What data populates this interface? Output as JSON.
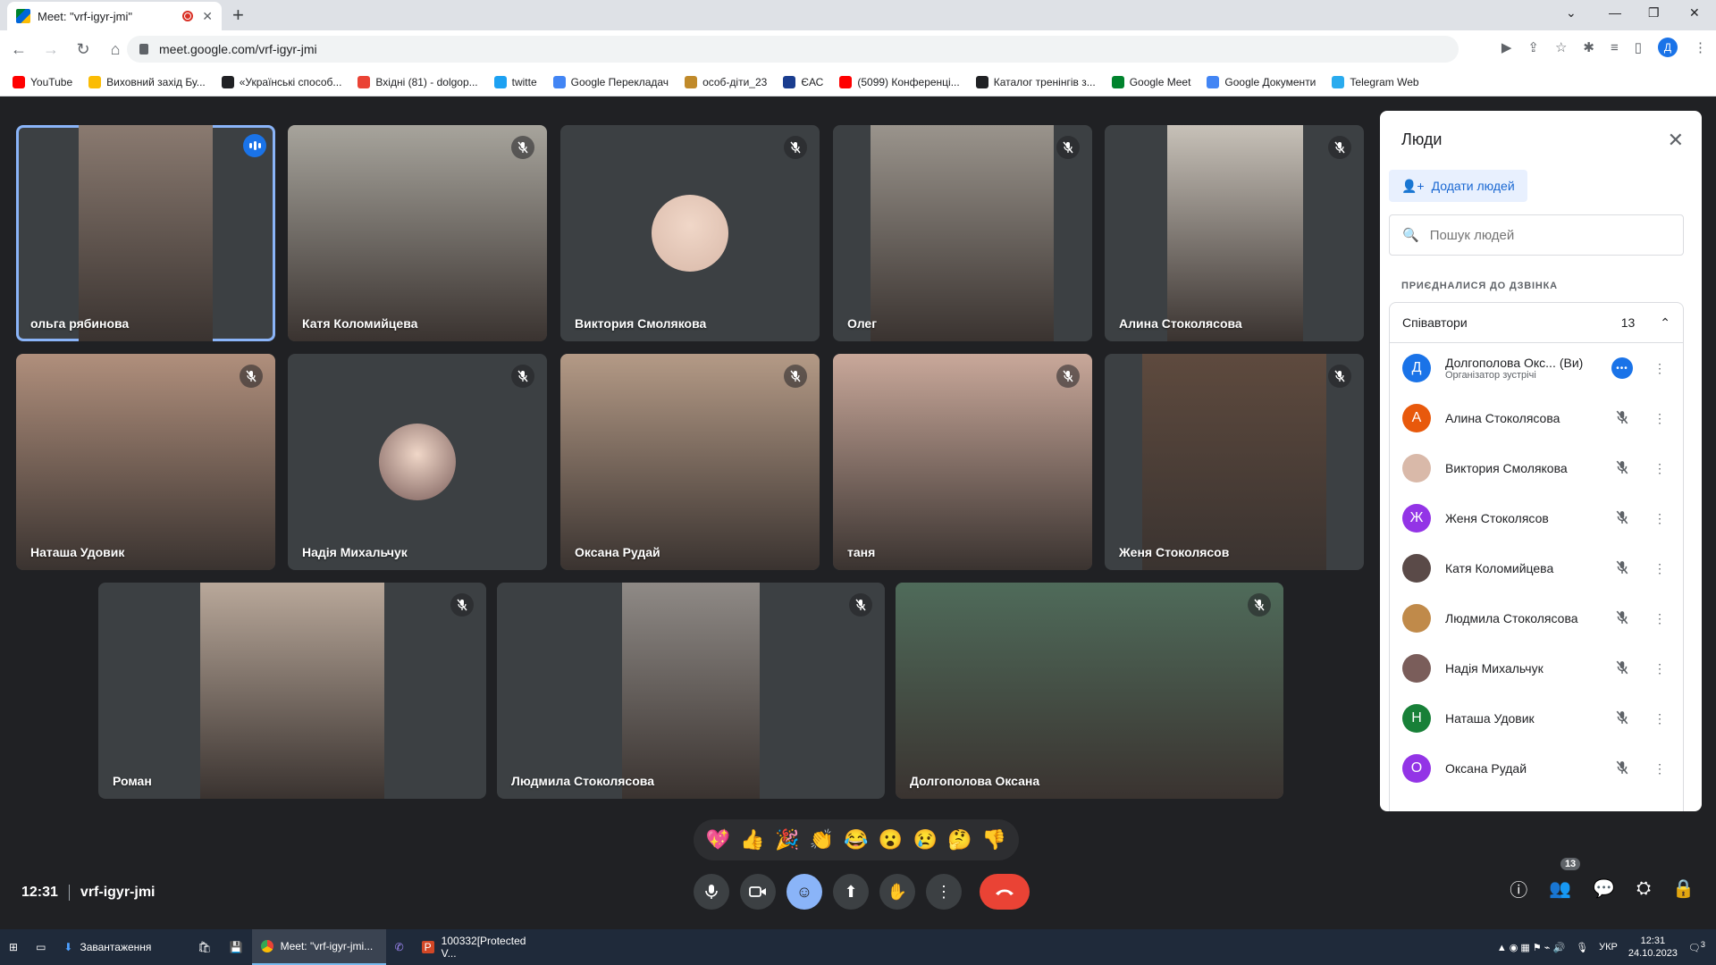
{
  "browser": {
    "tab_title": "Meet: \"vrf-igyr-jmi\"",
    "url": "meet.google.com/vrf-igyr-jmi",
    "profile_initial": "Д"
  },
  "bookmarks": [
    {
      "label": "YouTube",
      "color": "#ff0000"
    },
    {
      "label": "Виховний захід Бу...",
      "color": "#fbbc04"
    },
    {
      "label": "«Українські способ...",
      "color": "#202124"
    },
    {
      "label": "Вхідні (81) - dolgop...",
      "color": "#ea4335"
    },
    {
      "label": "twitte",
      "color": "#1da1f2"
    },
    {
      "label": "Google Перекладач",
      "color": "#4285f4"
    },
    {
      "label": "особ-діти_23",
      "color": "#c08a2a"
    },
    {
      "label": "ЄАС",
      "color": "#1a3d8f"
    },
    {
      "label": "(5099) Конференці...",
      "color": "#ff0000"
    },
    {
      "label": "Каталог тренінгів з...",
      "color": "#202124"
    },
    {
      "label": "Google Meet",
      "color": "#00832d"
    },
    {
      "label": "Google Документи",
      "color": "#4285f4"
    },
    {
      "label": "Telegram Web",
      "color": "#2aabee"
    }
  ],
  "tiles": [
    {
      "name": "ольга рябинова",
      "speaking": true,
      "bg": "#8a7a70"
    },
    {
      "name": "Катя Коломийцева",
      "speaking": false,
      "bg": "#a7a49c"
    },
    {
      "name": "Виктория Смолякова",
      "speaking": false,
      "avatar": "#d9b9a9"
    },
    {
      "name": "Олег",
      "speaking": false,
      "bg": "#9a948c"
    },
    {
      "name": "Алина Стоколясова",
      "speaking": false,
      "bg": "#c7c1b8"
    },
    {
      "name": "Наташа Удовик",
      "speaking": false,
      "bg": "#b08f7c"
    },
    {
      "name": "Надія Михальчук",
      "speaking": false,
      "avatar": "#7a5d5a"
    },
    {
      "name": "Оксана Рудай",
      "speaking": false,
      "bg": "#b49a86"
    },
    {
      "name": "таня",
      "speaking": false,
      "bg": "#c9a89a"
    },
    {
      "name": "Женя Стоколясов",
      "speaking": false,
      "bg": "#5e4a3e"
    },
    {
      "name": "Роман",
      "speaking": false,
      "bg": "#b9a89a"
    },
    {
      "name": "Людмила Стоколясова",
      "speaking": false,
      "bg": "#8f8a86"
    },
    {
      "name": "Долгополова Оксана",
      "speaking": false,
      "bg": "#4f6b5a"
    }
  ],
  "reactions": [
    "💖",
    "👍",
    "🎉",
    "👏",
    "😂",
    "😮",
    "😢",
    "🤔",
    "👎"
  ],
  "meeting": {
    "time": "12:31",
    "code": "vrf-igyr-jmi"
  },
  "controls": {
    "participants_count": "13"
  },
  "panel": {
    "title": "Люди",
    "add_people": "Додати людей",
    "search_placeholder": "Пошук людей",
    "joined_label": "ПРИЄДНАЛИСЯ ДО ДЗВІНКА",
    "group_label": "Співавтори",
    "group_count": "13",
    "people": [
      {
        "initial": "Д",
        "name": "Долгополова Окс...",
        "you": "(Ви)",
        "role": "Організатор зустрічі",
        "color": "#1a73e8"
      },
      {
        "initial": "А",
        "name": "Алина Стоколясова",
        "color": "#e8590c"
      },
      {
        "initial": "",
        "name": "Виктория Смолякова",
        "color": "#d9b9a9"
      },
      {
        "initial": "Ж",
        "name": "Женя Стоколясов",
        "color": "#9334e6"
      },
      {
        "initial": "",
        "name": "Катя Коломийцева",
        "color": "#5a4a48"
      },
      {
        "initial": "",
        "name": "Людмила Стоколясова",
        "color": "#c08a4a"
      },
      {
        "initial": "",
        "name": "Надія Михальчук",
        "color": "#7a5d5a"
      },
      {
        "initial": "Н",
        "name": "Наташа Удовик",
        "color": "#188038"
      },
      {
        "initial": "О",
        "name": "Оксана Рудай",
        "color": "#9334e6"
      }
    ]
  },
  "taskbar": {
    "items": [
      "Завантаження",
      "Meet: \"vrf-igyr-jmi...",
      "100332[Protected V..."
    ],
    "lang": "УКР",
    "time": "12:31",
    "date": "24.10.2023",
    "notif": "3"
  }
}
